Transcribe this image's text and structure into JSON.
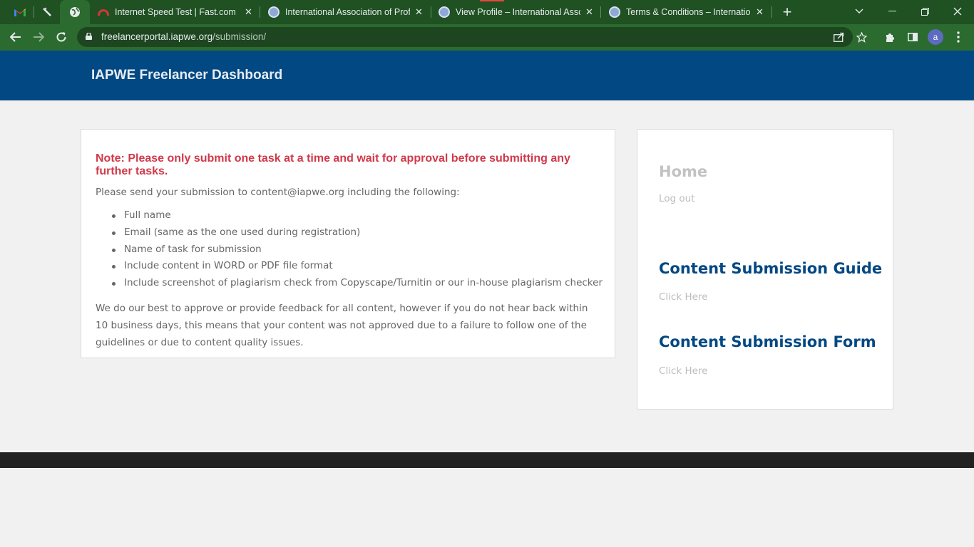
{
  "browser": {
    "tabs": [
      {
        "title": "Internet Speed Test | Fast.com"
      },
      {
        "title": "International Association of Profe"
      },
      {
        "title": "View Profile – International Assoc"
      },
      {
        "title": "Terms & Conditions – Internation"
      }
    ],
    "new_tab_symbol": "+",
    "url_host": "freelancerportal.iapwe.org",
    "url_path": "/submission/",
    "profile_initial": "a",
    "icons": {
      "pinned": [
        "gmail-icon",
        "pen-icon",
        "globe-icon"
      ],
      "toolbar": [
        "back-icon",
        "forward-icon",
        "reload-icon",
        "lock-icon",
        "share-icon",
        "star-icon",
        "extensions-icon",
        "sidepanel-icon",
        "menu-icon"
      ]
    }
  },
  "site": {
    "title": "IAPWE Freelancer Dashboard"
  },
  "main": {
    "note": "Note: Please only submit one task at a time and wait for approval before submitting any further tasks.",
    "intro": "Please send your submission to content@iapwe.org including the following:",
    "requirements": [
      "Full name",
      "Email (same as the one used during registration)",
      "Name of task for submission",
      "Include content in WORD or PDF file format",
      "Include screenshot of plagiarism check from Copyscape/Turnitin or our in-house plagiarism checker"
    ],
    "outro": "We do our best to approve or provide feedback for all content, however if you do not hear back within 10 business days, this means that your content was not approved due to a failure to follow one of the guidelines or due to content quality issues."
  },
  "sidebar": {
    "home": "Home",
    "logout": "Log out",
    "guide_heading": "Content Submission Guide",
    "guide_link": "Click Here",
    "form_heading": "Content Submission Form",
    "form_link": "Click Here"
  },
  "colors": {
    "browser_frame": "#1f5122",
    "site_header": "#024883",
    "note_red": "#d1394a",
    "heading_blue": "#024883"
  }
}
